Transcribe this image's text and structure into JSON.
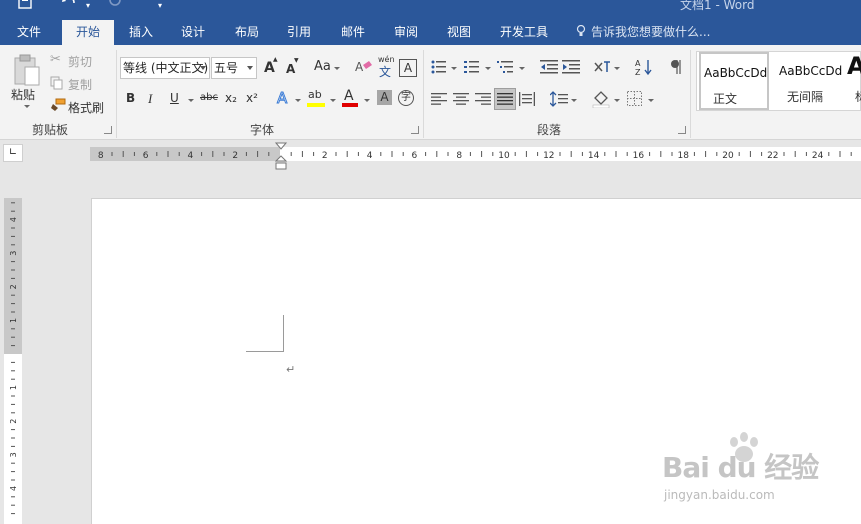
{
  "window": {
    "title": "文档1 - Word"
  },
  "tabs": [
    {
      "label": "文件",
      "active": false
    },
    {
      "label": "开始",
      "active": true
    },
    {
      "label": "插入",
      "active": false
    },
    {
      "label": "设计",
      "active": false
    },
    {
      "label": "布局",
      "active": false
    },
    {
      "label": "引用",
      "active": false
    },
    {
      "label": "邮件",
      "active": false
    },
    {
      "label": "审阅",
      "active": false
    },
    {
      "label": "视图",
      "active": false
    },
    {
      "label": "开发工具",
      "active": false
    }
  ],
  "tell_me": {
    "placeholder": "告诉我您想要做什么..."
  },
  "clipboard": {
    "group_label": "剪贴板",
    "paste": "粘贴",
    "cut": "剪切",
    "copy": "复制",
    "format_painter": "格式刷"
  },
  "font": {
    "group_label": "字体",
    "font_name": "等线 (中文正文)",
    "font_size": "五号",
    "grow": "A",
    "shrink": "A",
    "case": "Aa",
    "phonetic_top": "wén",
    "phonetic_bottom": "文",
    "border_char": "A",
    "bold": "B",
    "italic": "I",
    "underline": "U",
    "strike": "abc",
    "subscript": "x₂",
    "superscript": "x²",
    "text_effect": "A",
    "highlight": "ab",
    "font_color": "A",
    "char_shading": "A",
    "enclose_char": "字"
  },
  "paragraph": {
    "group_label": "段落"
  },
  "styles": {
    "items": [
      {
        "sample": "AaBbCcDd",
        "name": "正文",
        "selected": true
      },
      {
        "sample": "AaBbCcDd",
        "name": "无间隔",
        "selected": false
      },
      {
        "sample": "A",
        "name": "标",
        "selected": false
      }
    ]
  },
  "ruler": {
    "horizontal_labels": [
      "8",
      "6",
      "4",
      "2",
      "2",
      "4",
      "6",
      "8",
      "10",
      "12",
      "14",
      "16",
      "18",
      "20",
      "22",
      "24"
    ],
    "vertical_labels": [
      "4",
      "3",
      "2",
      "1",
      "1",
      "2",
      "3",
      "4"
    ]
  },
  "document": {
    "paragraph_mark": "↵"
  },
  "watermark": {
    "main": "Bai du 经验",
    "sub": "jingyan.baidu.com"
  },
  "colors": {
    "accent": "#2b579a",
    "ribbon": "#f3f3f3",
    "workspace": "#e6e6e6",
    "highlight_yellow": "#ffff00",
    "font_red": "#e00000"
  }
}
